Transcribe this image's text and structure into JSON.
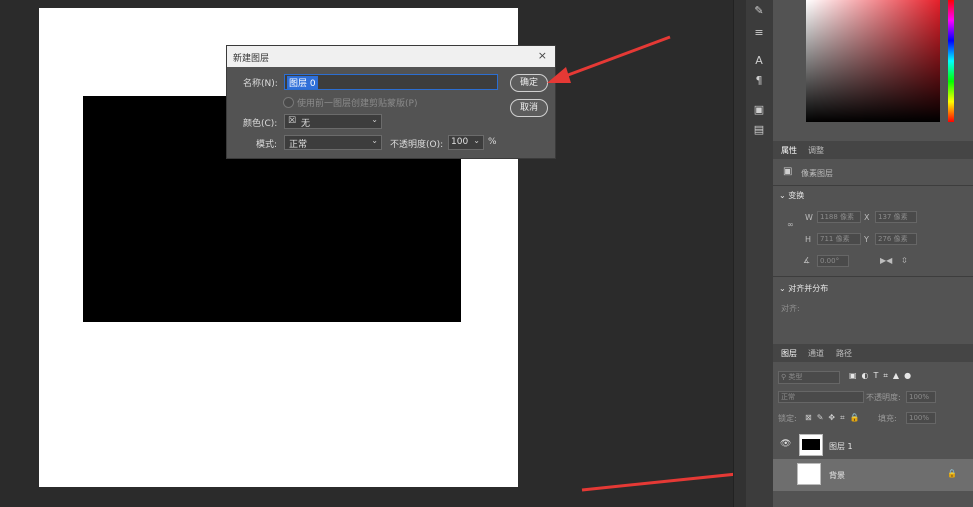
{
  "dialog": {
    "title": "新建图层",
    "name_label": "名称(N):",
    "name_value": "图层 0",
    "clip_label": "使用前一图层创建剪贴蒙版(P)",
    "color_label": "颜色(C):",
    "color_value": "无",
    "mode_label": "模式:",
    "mode_value": "正常",
    "opacity_label": "不透明度(O):",
    "opacity_value": "100",
    "opacity_unit": "%",
    "ok_label": "确定",
    "cancel_label": "取消"
  },
  "properties": {
    "tabs": [
      "属性",
      "调整"
    ],
    "pixel_layer": "像素图层",
    "transform_title": "变换",
    "w_label": "W",
    "w_value": "1188 像素",
    "x_label": "X",
    "x_value": "137 像素",
    "h_label": "H",
    "h_value": "711 像素",
    "y_label": "Y",
    "y_value": "276 像素",
    "angle_value": "0.00°",
    "align_title": "对齐并分布",
    "align_label": "对齐:"
  },
  "layers": {
    "tabs": [
      "图层",
      "通道",
      "路径"
    ],
    "filter_placeholder": "类型",
    "blend_mode": "正常",
    "opacity_label": "不透明度:",
    "opacity_value": "100%",
    "lock_label": "锁定:",
    "fill_label": "填充:",
    "fill_value": "100%",
    "items": [
      {
        "name": "图层 1"
      },
      {
        "name": "背景"
      }
    ]
  },
  "colors": {
    "accent": "#e53935",
    "selection": "#2f6fd8"
  }
}
